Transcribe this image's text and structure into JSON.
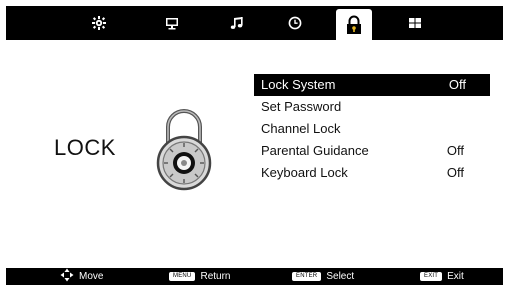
{
  "topbar": {
    "tabs": [
      {
        "name": "picture",
        "icon": "gear-icon"
      },
      {
        "name": "screen",
        "icon": "monitor-icon"
      },
      {
        "name": "sound",
        "icon": "music-note-icon"
      },
      {
        "name": "time",
        "icon": "clock-icon"
      },
      {
        "name": "lock",
        "icon": "padlock-icon",
        "active": true
      },
      {
        "name": "setup",
        "icon": "grid-icon"
      }
    ]
  },
  "section": {
    "title": "LOCK"
  },
  "menu": {
    "items": [
      {
        "label": "Lock System",
        "value": "Off",
        "selected": true
      },
      {
        "label": "Set Password",
        "value": ""
      },
      {
        "label": "Channel Lock",
        "value": ""
      },
      {
        "label": "Parental Guidance",
        "value": "Off"
      },
      {
        "label": "Keyboard Lock",
        "value": "Off"
      }
    ]
  },
  "footer": {
    "move_label": "Move",
    "menu_key": "MENU",
    "return_label": "Return",
    "enter_key": "ENTER",
    "select_label": "Select",
    "exit_key": "EXIT",
    "exit_label": "Exit"
  },
  "colors": {
    "bar": "#000000",
    "panel": "#ffffff",
    "highlight": "#000000"
  }
}
